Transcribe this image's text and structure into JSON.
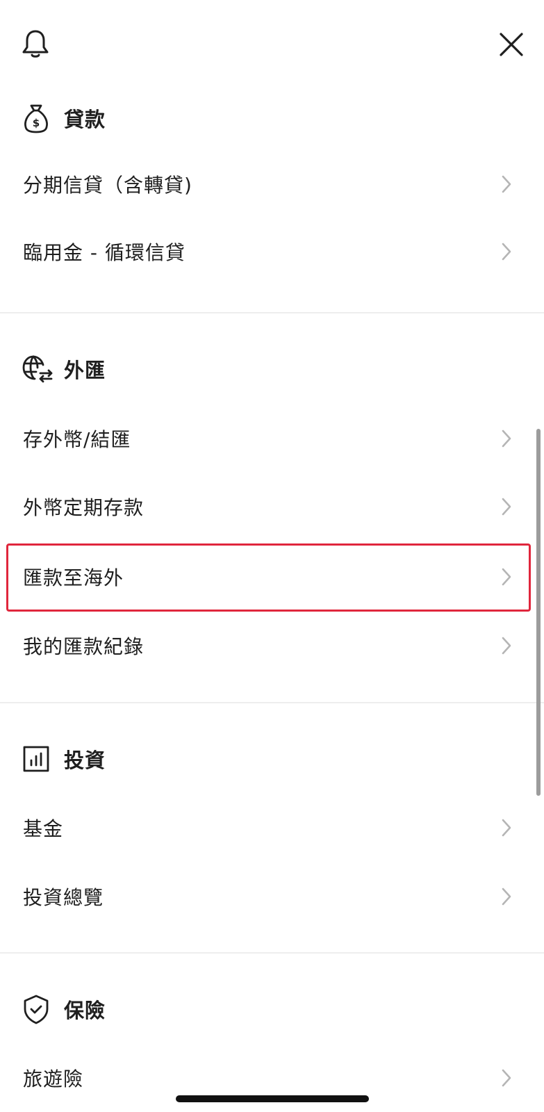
{
  "topbar": {
    "bell_icon": "bell-icon",
    "close_icon": "close-icon"
  },
  "sections": {
    "loans": {
      "icon": "money-bag-icon",
      "title": "貸款",
      "items": [
        {
          "label": "分期信貸（含轉貸)"
        },
        {
          "label": "臨用金 - 循環信貸"
        }
      ]
    },
    "forex": {
      "icon": "globe-exchange-icon",
      "title": "外匯",
      "items": [
        {
          "label": "存外幣/結匯"
        },
        {
          "label": "外幣定期存款"
        },
        {
          "label": "匯款至海外",
          "highlighted": true
        },
        {
          "label": "我的匯款紀錄"
        }
      ]
    },
    "investment": {
      "icon": "bar-chart-icon",
      "title": "投資",
      "items": [
        {
          "label": "基金"
        },
        {
          "label": "投資總覽"
        }
      ]
    },
    "insurance": {
      "icon": "shield-check-icon",
      "title": "保險",
      "items": [
        {
          "label": "旅遊險"
        }
      ]
    }
  },
  "colors": {
    "highlight_border": "#e0263c",
    "divider": "#eeeeee",
    "chevron": "#b5b5b5"
  }
}
